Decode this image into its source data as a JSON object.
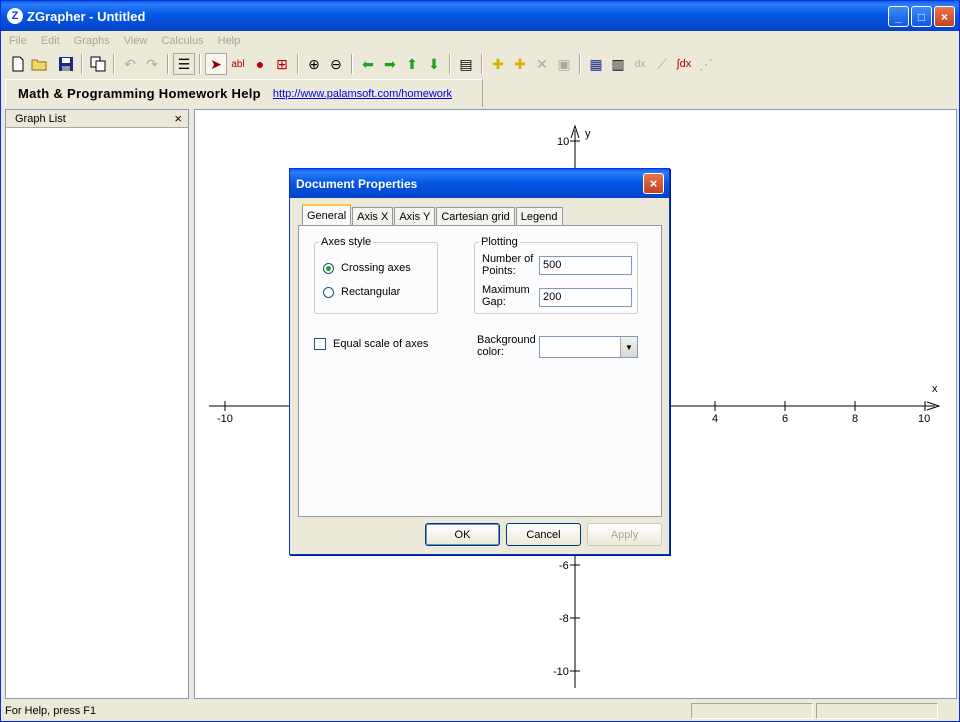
{
  "window": {
    "title": "ZGrapher - Untitled",
    "app_icon": "Z",
    "minimize": "_",
    "maximize": "□",
    "close": "×"
  },
  "menu": [
    "File",
    "Edit",
    "Graphs",
    "View",
    "Calculus",
    "Help"
  ],
  "toolbar_icons": [
    "new-icon",
    "open-icon",
    "save-icon",
    "copy-icon",
    "undo-icon",
    "redo-icon",
    "list-icon",
    "pointer-icon",
    "text-icon",
    "point-icon",
    "zoom-box-icon",
    "zoom-in-icon",
    "zoom-out-icon",
    "arrow-left-icon",
    "arrow-right-icon",
    "arrow-up-icon",
    "arrow-down-icon",
    "properties-icon",
    "add-graph-icon",
    "add-graph-2-icon",
    "delete-icon",
    "graph-props-icon",
    "table-icon",
    "calculator-icon",
    "derivative-icon",
    "tangent-icon",
    "integral-icon",
    "regression-icon"
  ],
  "linkbar": {
    "title": "Math & Programming Homework Help",
    "url": "http://www.palamsoft.com/homework"
  },
  "graph_list": {
    "title": "Graph List",
    "close": "×"
  },
  "axes": {
    "x_label": "x",
    "y_label": "y",
    "x_ticks": [
      "-10",
      "4",
      "6",
      "8",
      "10"
    ],
    "y_ticks": [
      "10",
      "-6",
      "-8",
      "-10"
    ]
  },
  "status": {
    "text": "For Help, press F1"
  },
  "dialog": {
    "title": "Document Properties",
    "close": "×",
    "tabs": [
      "General",
      "Axis X",
      "Axis Y",
      "Cartesian grid",
      "Legend"
    ],
    "axes_style": {
      "legend": "Axes style",
      "crossing": "Crossing axes",
      "rectangular": "Rectangular",
      "selected": "Crossing axes"
    },
    "plotting": {
      "legend": "Plotting",
      "points_label": "Number of Points:",
      "points_value": "500",
      "gap_label": "Maximum Gap:",
      "gap_value": "200"
    },
    "equal_scale": "Equal scale of axes",
    "bg_color_label": "Background color:",
    "ok": "OK",
    "cancel": "Cancel",
    "apply": "Apply"
  }
}
